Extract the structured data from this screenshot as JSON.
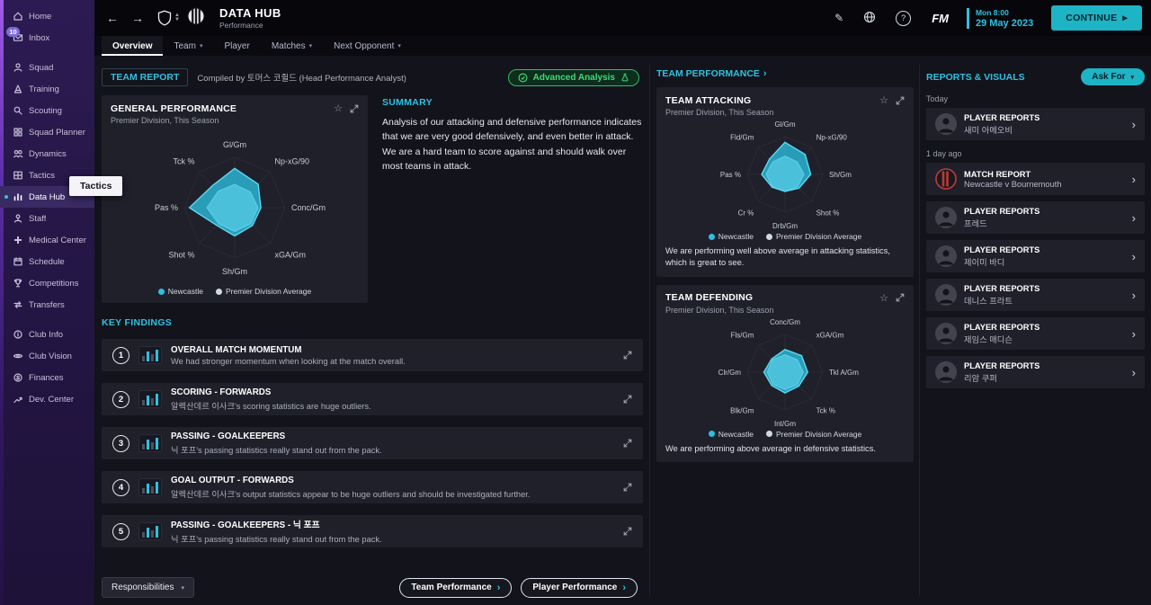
{
  "topbar": {
    "title": "DATA HUB",
    "subtitle": "Performance",
    "fm_badge": "FM",
    "datetime": {
      "line1": "Mon 8:00",
      "line2": "29 May 2023"
    },
    "continue_label": "CONTINUE",
    "tabs": [
      {
        "label": "Overview",
        "selected": true,
        "caret": false
      },
      {
        "label": "Team",
        "selected": false,
        "caret": true
      },
      {
        "label": "Player",
        "selected": false,
        "caret": false
      },
      {
        "label": "Matches",
        "selected": false,
        "caret": true
      },
      {
        "label": "Next Opponent",
        "selected": false,
        "caret": true
      }
    ]
  },
  "sidebar": {
    "tooltip": "Tactics",
    "groups": [
      {
        "items": [
          {
            "label": "Home",
            "icon": "home"
          },
          {
            "label": "Inbox",
            "icon": "inbox",
            "badge": "10"
          }
        ]
      },
      {
        "items": [
          {
            "label": "Squad",
            "icon": "squad"
          },
          {
            "label": "Training",
            "icon": "training"
          },
          {
            "label": "Scouting",
            "icon": "scouting"
          },
          {
            "label": "Squad Planner",
            "icon": "squad-planner"
          },
          {
            "label": "Dynamics",
            "icon": "dynamics"
          },
          {
            "label": "Tactics",
            "icon": "tactics"
          },
          {
            "label": "Data Hub",
            "icon": "data-hub",
            "selected": true
          },
          {
            "label": "Staff",
            "icon": "staff"
          },
          {
            "label": "Medical Center",
            "icon": "medical"
          },
          {
            "label": "Schedule",
            "icon": "schedule"
          },
          {
            "label": "Competitions",
            "icon": "competitions"
          },
          {
            "label": "Transfers",
            "icon": "transfers"
          }
        ]
      },
      {
        "items": [
          {
            "label": "Club Info",
            "icon": "club-info"
          },
          {
            "label": "Club Vision",
            "icon": "club-vision"
          },
          {
            "label": "Finances",
            "icon": "finances"
          },
          {
            "label": "Dev. Center",
            "icon": "dev-center"
          }
        ]
      }
    ]
  },
  "team_report": {
    "title": "TEAM REPORT",
    "compiled_by": "Compiled by 토머스 코쥘드 (Head Performance Analyst)",
    "advanced_analysis_label": "Advanced Analysis"
  },
  "general_performance": {
    "title": "GENERAL PERFORMANCE",
    "subtitle": "Premier Division, This Season"
  },
  "summary": {
    "heading": "SUMMARY",
    "text": "Analysis of our attacking and defensive performance indicates that we are very good defensively, and even better in attack. We are a hard team to score against and should walk over most teams in attack."
  },
  "key_findings": {
    "heading": "KEY FINDINGS",
    "items": [
      {
        "num": "1",
        "title": "OVERALL MATCH MOMENTUM",
        "desc": "We had stronger momentum when looking at the match overall."
      },
      {
        "num": "2",
        "title": "SCORING - FORWARDS",
        "desc": "알렉산데르 이사크's scoring statistics are huge outliers."
      },
      {
        "num": "3",
        "title": "PASSING - GOALKEEPERS",
        "desc": "닉 포프's passing statistics really stand out from the pack."
      },
      {
        "num": "4",
        "title": "GOAL OUTPUT - FORWARDS",
        "desc": "알렉산데르 이사크's output statistics appear to be huge outliers and should be investigated further."
      },
      {
        "num": "5",
        "title": "PASSING - GOALKEEPERS - 닉 포프",
        "desc": "닉 포프's passing statistics really stand out from the pack."
      }
    ]
  },
  "footer": {
    "responsibilities_label": "Responsibilities",
    "team_performance_label": "Team Performance",
    "player_performance_label": "Player Performance"
  },
  "team_performance_panel": {
    "heading": "TEAM PERFORMANCE",
    "attacking": {
      "title": "TEAM ATTACKING",
      "subtitle": "Premier Division, This Season",
      "note": "We are performing well above average in attacking statistics, which is great to see."
    },
    "defending": {
      "title": "TEAM DEFENDING",
      "subtitle": "Premier Division, This Season",
      "note": "We are performing above average in defensive statistics."
    }
  },
  "reports_panel": {
    "heading": "REPORTS & VISUALS",
    "ask_for_label": "Ask For",
    "groups": [
      {
        "time_label": "Today",
        "items": [
          {
            "type": "player",
            "title": "PLAYER REPORTS",
            "subject": "새미 아메오비"
          }
        ]
      },
      {
        "time_label": "1 day ago",
        "items": [
          {
            "type": "match",
            "title": "MATCH REPORT",
            "subject": "Newcastle v Bournemouth"
          },
          {
            "type": "player",
            "title": "PLAYER REPORTS",
            "subject": "프레드"
          },
          {
            "type": "player",
            "title": "PLAYER REPORTS",
            "subject": "제이미 바디"
          },
          {
            "type": "player",
            "title": "PLAYER REPORTS",
            "subject": "데니스 프라트"
          },
          {
            "type": "player",
            "title": "PLAYER REPORTS",
            "subject": "제임스 매디슨"
          },
          {
            "type": "player",
            "title": "PLAYER REPORTS",
            "subject": "리암 쿠퍼"
          }
        ]
      }
    ]
  },
  "chart_data": [
    {
      "type": "radar",
      "title": "General Performance",
      "axes": [
        "Gl/Gm",
        "Np-xG/90",
        "Conc/Gm",
        "xGA/Gm",
        "Sh/Gm",
        "Shot %",
        "Pas %",
        "Tck %"
      ],
      "scale": [
        0,
        1
      ],
      "series": [
        {
          "name": "Newcastle",
          "color": "#2bc0e0",
          "stroke": "#5fd9f2",
          "values": [
            0.78,
            0.66,
            0.52,
            0.5,
            0.56,
            0.5,
            0.9,
            0.62
          ]
        },
        {
          "name": "Premier Division Average",
          "color": "#d2d9de",
          "stroke": "#eef2f6",
          "values": [
            0.46,
            0.44,
            0.46,
            0.45,
            0.47,
            0.45,
            0.55,
            0.46
          ]
        }
      ],
      "legend_position": "bottom"
    },
    {
      "type": "radar",
      "title": "Team Attacking",
      "axes": [
        "Gl/Gm",
        "Np-xG/90",
        "Sh/Gm",
        "Shot %",
        "Drb/Gm",
        "Cr %",
        "Pas %",
        "Fld/Gm"
      ],
      "scale": [
        0,
        1
      ],
      "series": [
        {
          "name": "Newcastle",
          "color": "#2bc0e0",
          "stroke": "#5fd9f2",
          "values": [
            0.85,
            0.75,
            0.68,
            0.52,
            0.45,
            0.48,
            0.62,
            0.58
          ]
        },
        {
          "name": "Premier Division Average",
          "color": "#d2d9de",
          "stroke": "#eef2f6",
          "values": [
            0.48,
            0.46,
            0.5,
            0.46,
            0.45,
            0.46,
            0.5,
            0.46
          ]
        }
      ],
      "legend_position": "bottom"
    },
    {
      "type": "radar",
      "title": "Team Defending",
      "axes": [
        "Conc/Gm",
        "xGA/Gm",
        "Tkl A/Gm",
        "Tck %",
        "Int/Gm",
        "Blk/Gm",
        "Clr/Gm",
        "Fls/Gm"
      ],
      "scale": [
        0,
        1
      ],
      "series": [
        {
          "name": "Newcastle",
          "color": "#2bc0e0",
          "stroke": "#5fd9f2",
          "values": [
            0.6,
            0.62,
            0.6,
            0.52,
            0.55,
            0.5,
            0.56,
            0.5
          ]
        },
        {
          "name": "Premier Division Average",
          "color": "#d2d9de",
          "stroke": "#eef2f6",
          "values": [
            0.46,
            0.46,
            0.48,
            0.46,
            0.46,
            0.45,
            0.47,
            0.46
          ]
        }
      ],
      "legend_position": "bottom"
    }
  ]
}
